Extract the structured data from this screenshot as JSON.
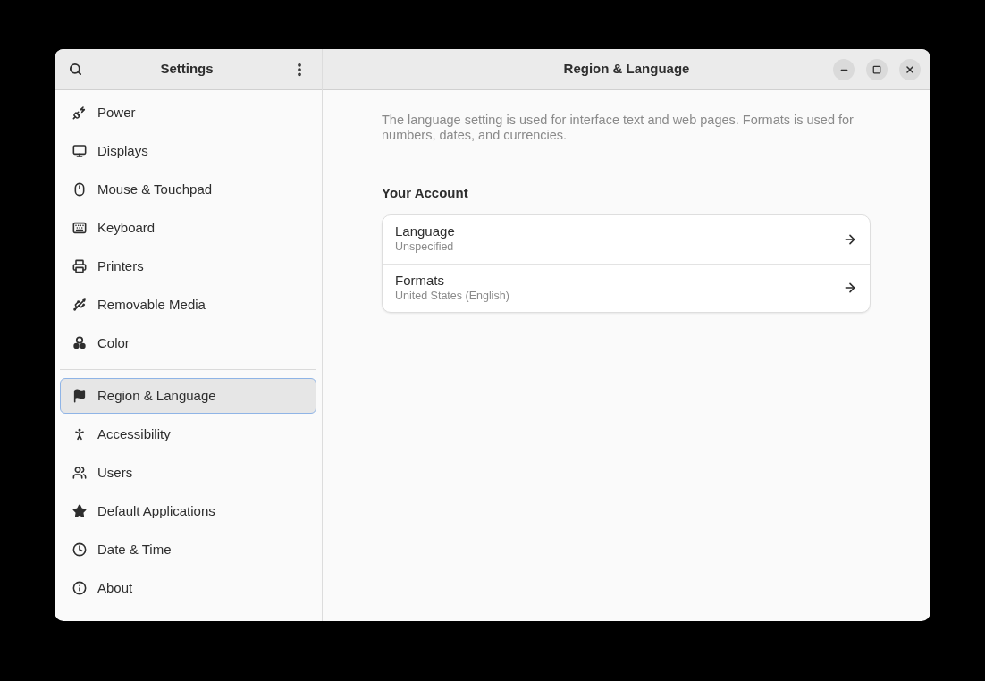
{
  "sidebar": {
    "title": "Settings",
    "groups": [
      {
        "items": [
          {
            "label": "Power",
            "selected": false
          },
          {
            "label": "Displays",
            "selected": false
          },
          {
            "label": "Mouse & Touchpad",
            "selected": false
          },
          {
            "label": "Keyboard",
            "selected": false
          },
          {
            "label": "Printers",
            "selected": false
          },
          {
            "label": "Removable Media",
            "selected": false
          },
          {
            "label": "Color",
            "selected": false
          }
        ]
      },
      {
        "items": [
          {
            "label": "Region & Language",
            "selected": true
          },
          {
            "label": "Accessibility",
            "selected": false
          },
          {
            "label": "Users",
            "selected": false
          },
          {
            "label": "Default Applications",
            "selected": false
          },
          {
            "label": "Date & Time",
            "selected": false
          },
          {
            "label": "About",
            "selected": false
          }
        ]
      }
    ]
  },
  "window": {
    "title": "Region & Language"
  },
  "description": "The language setting is used for interface text and web pages. Formats is used for numbers, dates, and currencies.",
  "section": {
    "title": "Your Account",
    "rows": [
      {
        "title": "Language",
        "subtitle": "Unspecified"
      },
      {
        "title": "Formats",
        "subtitle": "United States (English)"
      }
    ]
  }
}
